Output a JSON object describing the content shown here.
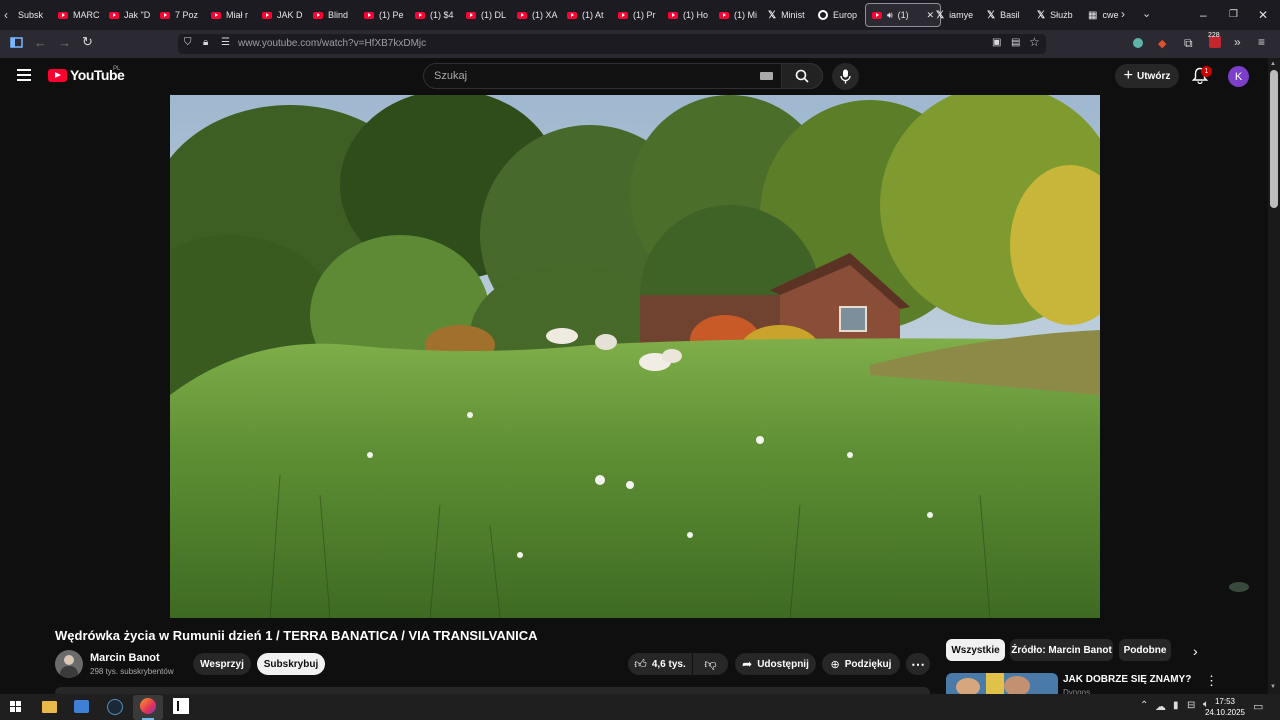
{
  "browser": {
    "tabs": [
      {
        "label": "Subsk",
        "kind": "plain"
      },
      {
        "label": "MARC",
        "kind": "yt"
      },
      {
        "label": "Jak \"D",
        "kind": "yt"
      },
      {
        "label": "7 Poz",
        "kind": "yt"
      },
      {
        "label": "Miał r",
        "kind": "yt"
      },
      {
        "label": "JAK D",
        "kind": "yt"
      },
      {
        "label": "Blind",
        "kind": "yt"
      },
      {
        "label": "(1) Pe",
        "kind": "yt"
      },
      {
        "label": "(1) $4",
        "kind": "yt"
      },
      {
        "label": "(1) DL",
        "kind": "yt"
      },
      {
        "label": "(1) XA",
        "kind": "yt"
      },
      {
        "label": "(1) At",
        "kind": "yt"
      },
      {
        "label": "(1) Pr",
        "kind": "yt"
      },
      {
        "label": "(1) Ho",
        "kind": "yt"
      },
      {
        "label": "(1) Mi",
        "kind": "yt"
      },
      {
        "label": "Minist",
        "kind": "x"
      },
      {
        "label": "Europ",
        "kind": "web"
      },
      {
        "label": "(1)",
        "kind": "active"
      },
      {
        "label": "iamye",
        "kind": "x"
      },
      {
        "label": "Basil",
        "kind": "x"
      },
      {
        "label": "Służb",
        "kind": "x"
      },
      {
        "label": "cwe",
        "kind": "doc"
      }
    ],
    "url": "www.youtube.com/watch?v=HfXB7kxDMjc",
    "extension_badge": "228"
  },
  "youtube": {
    "logo_text": "YouTube",
    "region": "PL",
    "search_placeholder": "Szukaj",
    "create_label": "Utwórz",
    "notification_count": "1",
    "avatar_letter": "K"
  },
  "video": {
    "title": "Wędrówka życia w Rumunii dzień 1 / TERRA BANATICA / VIA TRANSILVANICA",
    "channel_name": "Marcin Banot",
    "subscribers": "298 tys. subskrybentów",
    "support_label": "Wesprzyj",
    "subscribe_label": "Subskrybuj",
    "likes": "4,6 tys.",
    "share_label": "Udostępnij",
    "thanks_label": "Podziękuj"
  },
  "filters": {
    "chips": [
      "Wszystkie",
      "Źródło: Marcin Banot",
      "Podobne"
    ],
    "selected": "Wszystkie"
  },
  "recommendation": {
    "title": "JAK DOBRZE SIĘ ZNAMY?",
    "channel": "Dyngos"
  },
  "taskbar": {
    "time": "17:53",
    "date": "24.10.2025"
  },
  "colors": {
    "accent_red": "#ff0033",
    "avatar_purple": "#7b3fc9",
    "background": "#0f0f0f"
  }
}
